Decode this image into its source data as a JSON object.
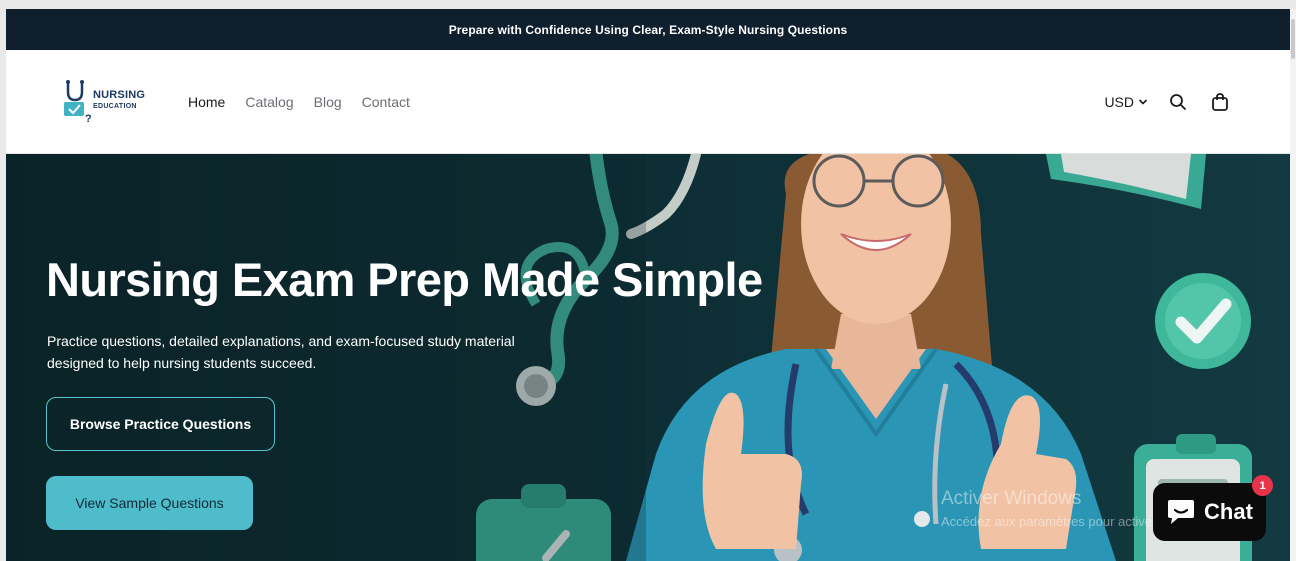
{
  "announcement": {
    "text": "Prepare with Confidence Using Clear, Exam-Style Nursing Questions"
  },
  "logo": {
    "line1": "NURSING",
    "line2": "EDUCATION"
  },
  "nav": {
    "items": [
      {
        "label": "Home",
        "active": true
      },
      {
        "label": "Catalog",
        "active": false
      },
      {
        "label": "Blog",
        "active": false
      },
      {
        "label": "Contact",
        "active": false
      }
    ]
  },
  "header_actions": {
    "currency": "USD",
    "icons": [
      "chevron-down-icon",
      "search-icon",
      "shopping-bag-icon"
    ]
  },
  "hero": {
    "title": "Nursing Exam Prep Made Simple",
    "subtitle": "Practice questions, detailed explanations, and exam-focused study material designed to help nursing students succeed.",
    "primary_button": "Browse Practice Questions",
    "secondary_button": "View Sample Questions"
  },
  "watermark": {
    "line1": "Activer Windows",
    "line2": "Accédez aux paramètres pour activer Windows."
  },
  "chat": {
    "label": "Chat",
    "badge": "1"
  },
  "colors": {
    "announcement_bg": "#0f1f2e",
    "hero_bg": "#0c2a30",
    "accent": "#4fbccc",
    "scrubs": "#2b95b5",
    "chat_bg": "#0b0b0b",
    "badge": "#e8344a"
  }
}
